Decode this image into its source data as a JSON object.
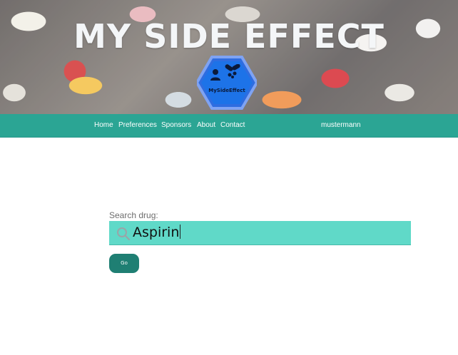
{
  "header": {
    "title": "MY SIDE EFFECT",
    "logo_text": "MySideEffect",
    "logo_icons": [
      "user-icon",
      "pills-icon"
    ]
  },
  "nav": {
    "items": [
      "Home",
      "Preferences",
      "Sponsors",
      "About",
      "Contact"
    ],
    "username": "mustermann",
    "bg_color": "#2ba594"
  },
  "search": {
    "label": "Search drug:",
    "value": "Aspirin",
    "field_color": "#60d9c8",
    "icon": "search-icon"
  },
  "actions": {
    "go_label": "Go",
    "go_color": "#1f7f73"
  }
}
